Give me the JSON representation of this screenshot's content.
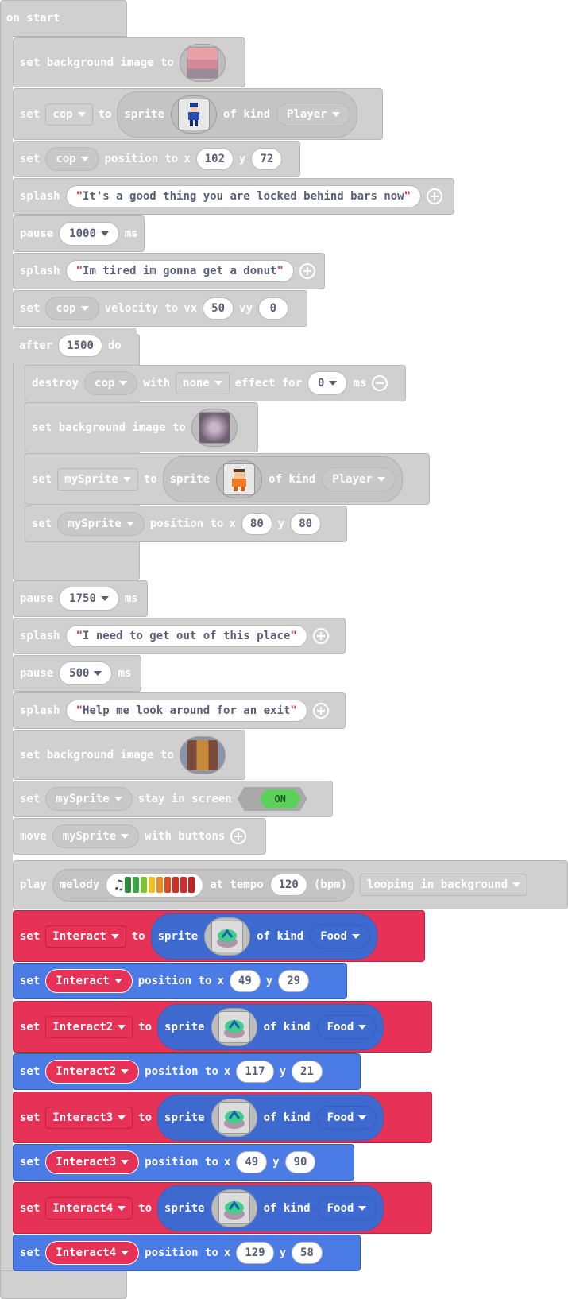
{
  "hat": {
    "label": "on start"
  },
  "kw": {
    "set": "set",
    "splash": "splash",
    "pause": "pause",
    "after": "after",
    "do": "do",
    "destroy": "destroy",
    "with": "with",
    "effect_for": "effect for",
    "move": "move",
    "with_buttons": "with buttons",
    "play": "play",
    "melody": "melody",
    "at_tempo": "at tempo",
    "bpm": "(bpm)",
    "to": "to",
    "sprite": "sprite",
    "of_kind": "of kind",
    "position_to": "position to",
    "x": "x",
    "y": "y",
    "velocity_to": "velocity to",
    "vx": "vx",
    "vy": "vy",
    "ms": "ms",
    "bg_to": "set background image to",
    "stay_in_screen": "stay in screen"
  },
  "b3": {
    "var": "cop",
    "kind": "Player"
  },
  "b4": {
    "var": "cop",
    "x": "102",
    "y": "72"
  },
  "b5": {
    "text": "It's a good thing you are locked behind bars now"
  },
  "b6": {
    "ms": "1000"
  },
  "b7": {
    "text": "Im tired im gonna get a donut"
  },
  "b8": {
    "var": "cop",
    "vx": "50",
    "vy": "0"
  },
  "b9": {
    "ms": "1500"
  },
  "b10": {
    "var": "cop",
    "effect": "none",
    "ms": "0"
  },
  "b12": {
    "var": "mySprite",
    "kind": "Player"
  },
  "b13": {
    "var": "mySprite",
    "x": "80",
    "y": "80"
  },
  "b14": {
    "ms": "1750"
  },
  "b15": {
    "text": "I need to get out of this place"
  },
  "b16": {
    "ms": "500"
  },
  "b17": {
    "text": "Help me look around for an exit"
  },
  "b19": {
    "var": "mySprite",
    "toggle": "ON"
  },
  "b20": {
    "var": "mySprite"
  },
  "b21": {
    "tempo": "120",
    "mode": "looping in background"
  },
  "melody_colors": [
    "#2e8b3a",
    "#3aa845",
    "#7cc23a",
    "#f0c020",
    "#f08a20",
    "#e04a20",
    "#d03020",
    "#d82a2a",
    "#c82020"
  ],
  "food": [
    {
      "var": "Interact",
      "kind": "Food",
      "x": "49",
      "y": "29"
    },
    {
      "var": "Interact2",
      "kind": "Food",
      "x": "117",
      "y": "21"
    },
    {
      "var": "Interact3",
      "kind": "Food",
      "x": "49",
      "y": "90"
    },
    {
      "var": "Interact4",
      "kind": "Food",
      "x": "129",
      "y": "58"
    }
  ]
}
